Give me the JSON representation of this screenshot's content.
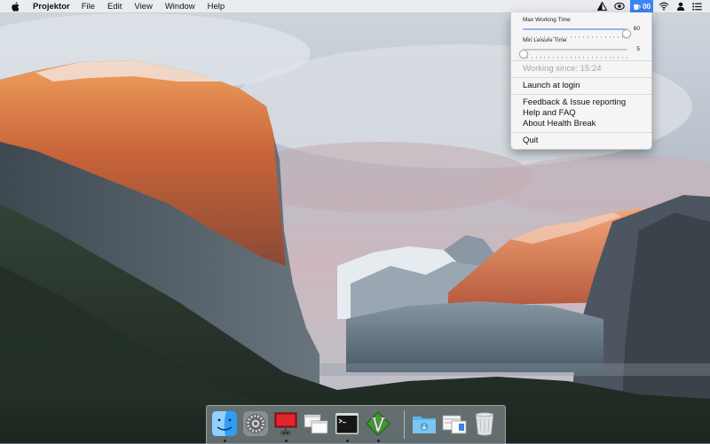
{
  "menubar": {
    "apple_icon": "apple-logo-icon",
    "app_name": "Projektor",
    "items": [
      "File",
      "Edit",
      "View",
      "Window",
      "Help"
    ],
    "status_icons": [
      "triangle-icon",
      "eye-icon",
      "cup-icon",
      "wifi-icon",
      "user-icon",
      "list-icon"
    ],
    "health_break_counter": "00"
  },
  "dropdown": {
    "max_working_time": {
      "label": "Max Working Time",
      "value": "60",
      "fraction": 0.98
    },
    "min_leisure_time": {
      "label": "Min Leisure Time",
      "value": "5",
      "fraction": 0.0
    },
    "working_since": "Working since: 15:24",
    "launch_at_login": "Launch at login",
    "feedback": "Feedback & Issue reporting",
    "help_faq": "Help and FAQ",
    "about": "About Health Break",
    "quit": "Quit"
  },
  "dock": {
    "apps": [
      {
        "name": "finder-icon",
        "running": true
      },
      {
        "name": "system-preferences-icon",
        "running": false
      },
      {
        "name": "projektor-icon",
        "running": true
      },
      {
        "name": "windows-icon",
        "running": false
      },
      {
        "name": "terminal-icon",
        "running": true
      },
      {
        "name": "vim-icon",
        "running": true
      }
    ],
    "others": [
      "downloads-folder-icon",
      "preview-icon",
      "trash-icon"
    ]
  },
  "colors": {
    "menu_highlight": "#3d84f6",
    "slider_fill": "#8fb6f5",
    "disabled_text": "#a6a6a6"
  }
}
